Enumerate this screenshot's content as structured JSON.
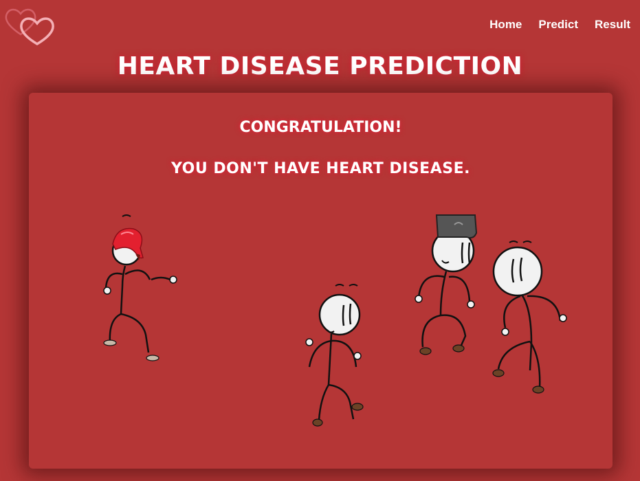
{
  "nav": {
    "items": [
      {
        "label": "Home"
      },
      {
        "label": "Predict"
      },
      {
        "label": "Result"
      }
    ]
  },
  "header": {
    "title": "HEART DISEASE PREDICTION"
  },
  "result": {
    "heading": "CONGRATULATION!",
    "message": "YOU DON'T HAVE HEART DISEASE."
  },
  "colors": {
    "background": "#b53636",
    "text": "#ffffff",
    "glow": "#d62638",
    "heart_outline": "#f4a0a8"
  },
  "icons": {
    "logo": "double-heart-icon"
  }
}
